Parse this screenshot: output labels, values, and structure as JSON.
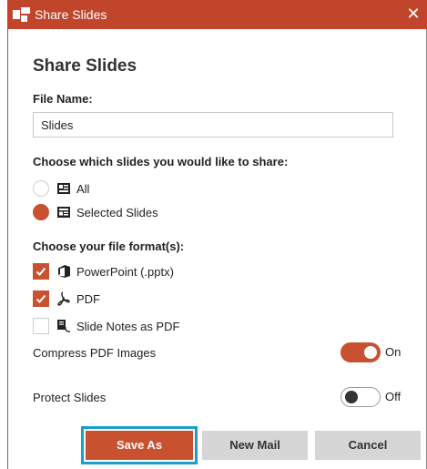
{
  "window": {
    "title": "Share Slides",
    "accent": "#c0452b",
    "close_symbol": "✕"
  },
  "dialog": {
    "heading": "Share Slides",
    "file_name_label": "File Name:",
    "file_name_value": "Slides",
    "choose_slides_label": "Choose which slides you would like to share:",
    "slide_options": [
      {
        "label": "All",
        "selected": false,
        "icon": "presentation-icon"
      },
      {
        "label": "Selected Slides",
        "selected": true,
        "icon": "slides-list-icon"
      }
    ],
    "file_format_label": "Choose your file format(s):",
    "formats": [
      {
        "label": "PowerPoint (.pptx)",
        "checked": true,
        "icon": "office-icon"
      },
      {
        "label": "PDF",
        "checked": true,
        "icon": "acrobat-icon"
      },
      {
        "label": "Slide Notes as PDF",
        "checked": false,
        "icon": "notes-pdf-icon"
      }
    ],
    "compress": {
      "label": "Compress PDF Images",
      "state": "On",
      "on": true
    },
    "protect": {
      "label": "Protect Slides",
      "state": "Off",
      "on": false
    },
    "buttons": {
      "save_as": "Save As",
      "new_mail": "New Mail",
      "cancel": "Cancel"
    }
  }
}
